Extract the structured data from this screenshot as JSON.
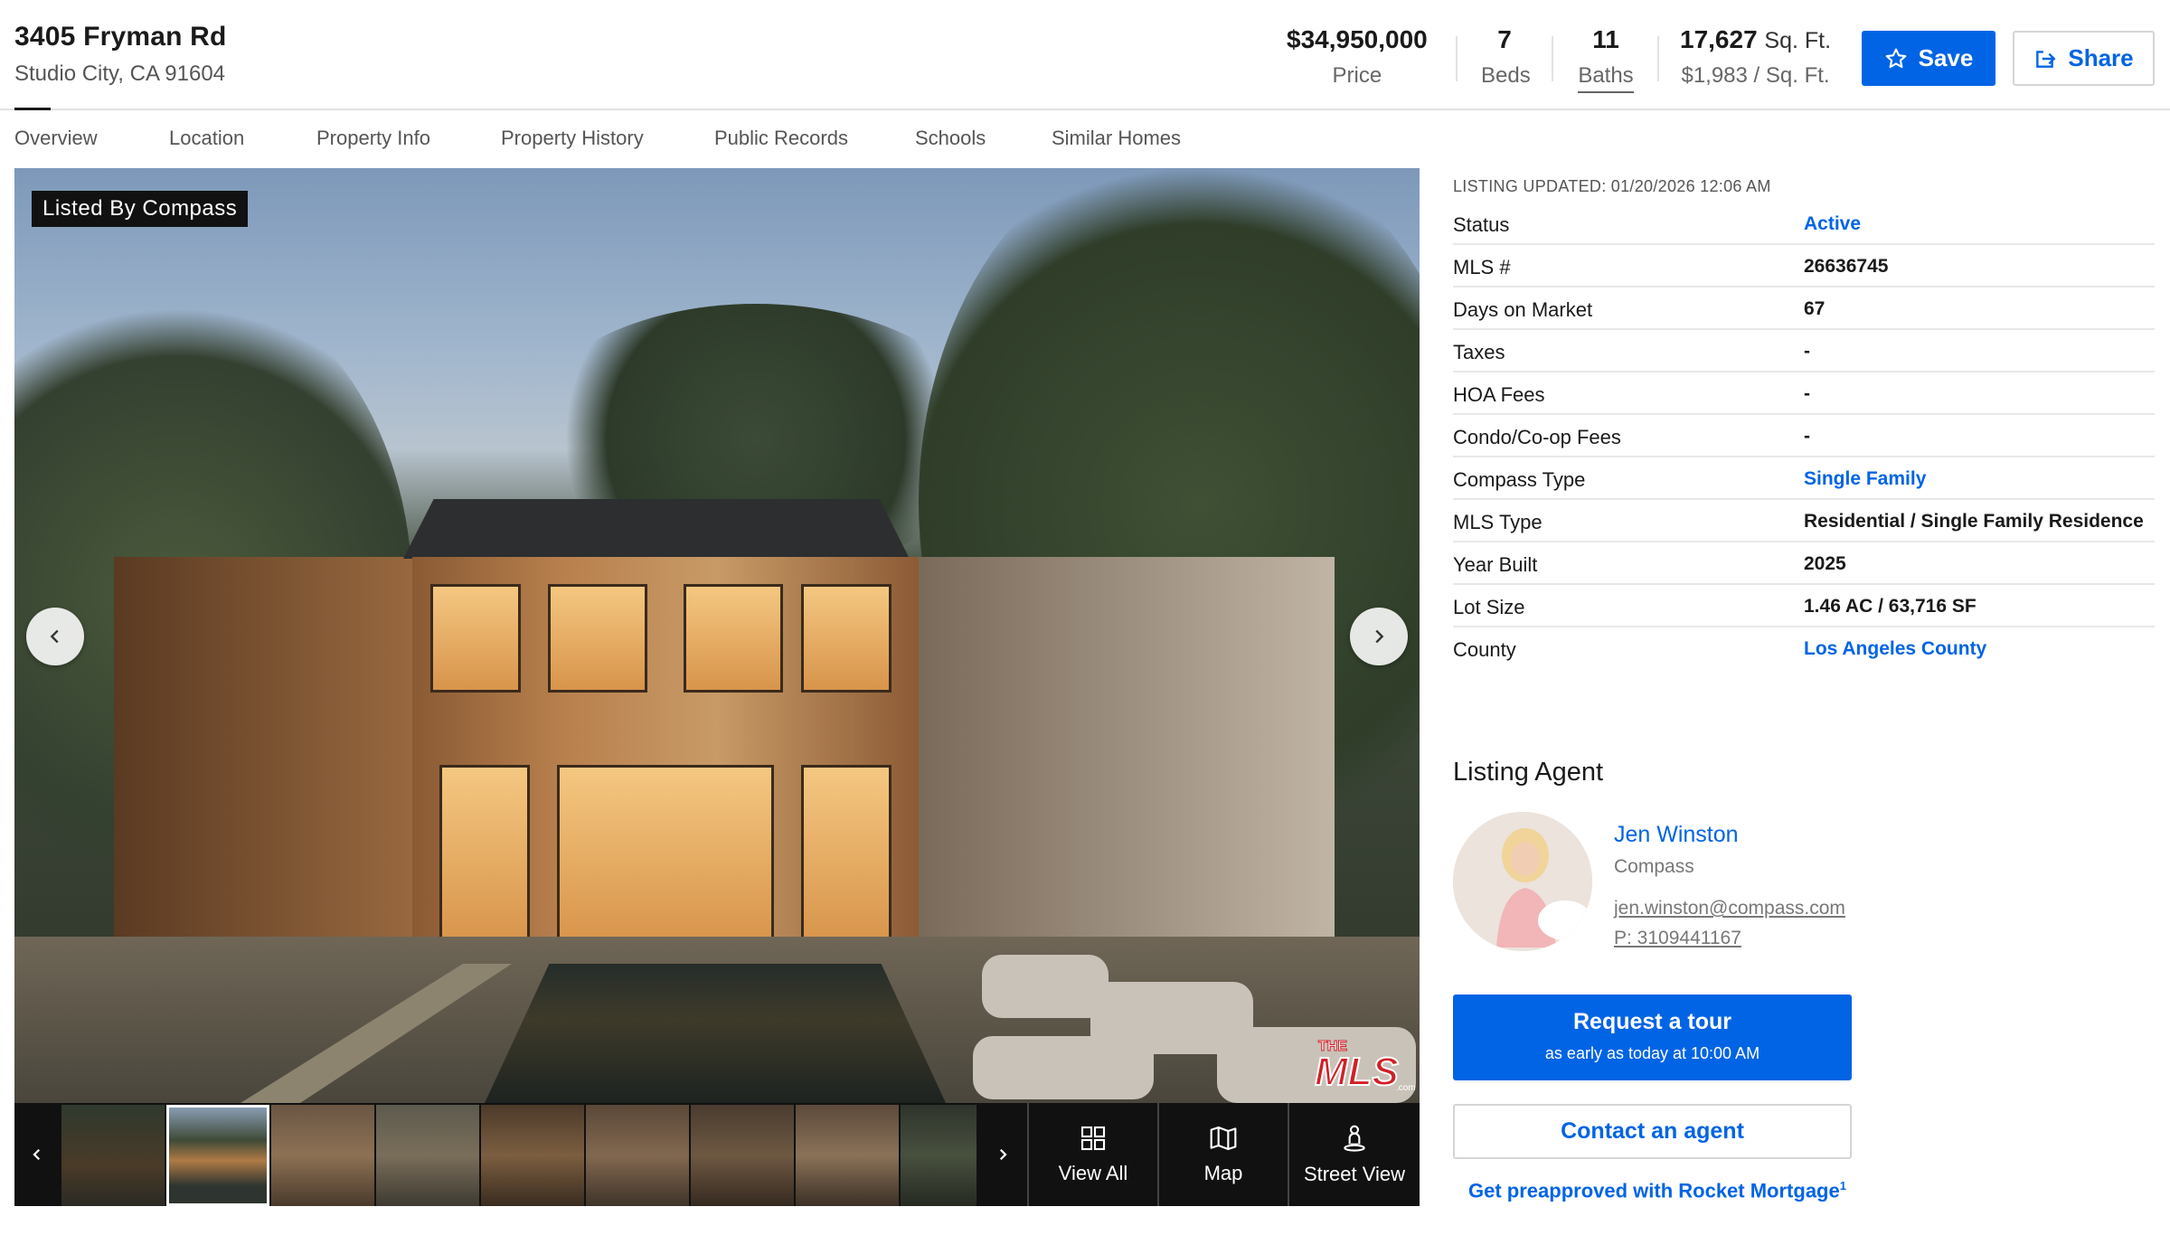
{
  "header": {
    "street": "3405 Fryman Rd",
    "city": "Studio City, CA 91604",
    "price": "$34,950,000",
    "price_label": "Price",
    "beds": "7",
    "beds_label": "Beds",
    "baths": "11",
    "baths_label": "Baths",
    "sqft": "17,627",
    "sqft_unit": "Sq. Ft.",
    "price_per_sqft": "$1,983 / Sq. Ft.",
    "save_label": "Save",
    "share_label": "Share",
    "accent_color": "#0064e5"
  },
  "tabs": [
    "Overview",
    "Location",
    "Property Info",
    "Property History",
    "Public Records",
    "Schools",
    "Similar Homes"
  ],
  "photo": {
    "badge": "Listed By Compass",
    "prev_icon": "chevron-left-icon",
    "next_icon": "chevron-right-icon",
    "watermark_text": "THE MLS.com"
  },
  "strip": {
    "thumbnail_count": 9,
    "active_index": 1,
    "tools": [
      {
        "label": "View All",
        "icon": "grid-icon"
      },
      {
        "label": "Map",
        "icon": "map-icon"
      },
      {
        "label": "Street View",
        "icon": "person-pin-icon"
      }
    ]
  },
  "listing": {
    "updated": "LISTING UPDATED: 01/20/2026 12:06 AM",
    "rows": [
      {
        "label": "Status",
        "value": "Active"
      },
      {
        "label": "MLS #",
        "value": "26636745"
      },
      {
        "label": "Days on Market",
        "value": "67"
      },
      {
        "label": "Taxes",
        "value": "-"
      },
      {
        "label": "HOA Fees",
        "value": "-"
      },
      {
        "label": "Condo/Co-op Fees",
        "value": "-"
      },
      {
        "label": "Compass Type",
        "value": "Single Family"
      },
      {
        "label": "MLS Type",
        "value": "Residential / Single Family Residence"
      },
      {
        "label": "Year Built",
        "value": "2025"
      },
      {
        "label": "Lot Size",
        "value": "1.46 AC / 63,716 SF"
      },
      {
        "label": "County",
        "value": "Los Angeles County"
      }
    ]
  },
  "agent": {
    "heading": "Listing Agent",
    "name": "Jen Winston",
    "company": "Compass",
    "email": "jen.winston@compass.com",
    "phone": "P: 3109441167"
  },
  "actions": {
    "tour_label": "Request a tour",
    "tour_sub": "as early as today at 10:00 AM",
    "contact_label": "Contact an agent",
    "preapproved_label": "Get preapproved with Rocket Mortgage",
    "preapproved_sup": "1"
  }
}
